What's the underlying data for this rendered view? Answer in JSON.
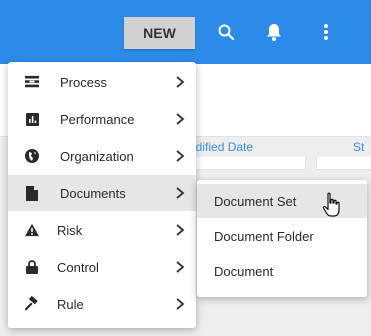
{
  "toolbar": {
    "new_label": "NEW",
    "icons": [
      "search-icon",
      "bell-icon",
      "more-vertical-icon"
    ],
    "accent_color": "#2c8be8"
  },
  "background": {
    "columns": [
      "odified Date",
      "St"
    ]
  },
  "menu": {
    "items": [
      {
        "label": "Process",
        "icon": "process-icon"
      },
      {
        "label": "Performance",
        "icon": "chart-icon"
      },
      {
        "label": "Organization",
        "icon": "globe-icon"
      },
      {
        "label": "Documents",
        "icon": "document-icon",
        "active": true
      },
      {
        "label": "Risk",
        "icon": "warning-icon"
      },
      {
        "label": "Control",
        "icon": "lock-icon"
      },
      {
        "label": "Rule",
        "icon": "gavel-icon"
      }
    ]
  },
  "submenu": {
    "items": [
      {
        "label": "Document Set",
        "hover": true
      },
      {
        "label": "Document Folder"
      },
      {
        "label": "Document"
      }
    ]
  }
}
